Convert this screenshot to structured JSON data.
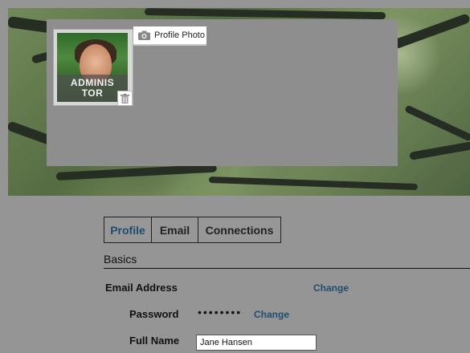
{
  "header": {
    "avatar_label": "ADMINIS\nTOR",
    "profile_photo_label": "Profile Photo"
  },
  "tabs": [
    {
      "label": "Profile",
      "active": true
    },
    {
      "label": "Email",
      "active": false
    },
    {
      "label": "Connections",
      "active": false
    }
  ],
  "section": {
    "title": "Basics"
  },
  "fields": {
    "email": {
      "label": "Email Address",
      "action": "Change"
    },
    "password": {
      "label": "Password",
      "masked_value": "••••••••",
      "action": "Change"
    },
    "full_name": {
      "label": "Full Name",
      "value": "Jane Hansen"
    }
  },
  "colors": {
    "accent_link": "#1f4d6e",
    "page_background": "#959595"
  },
  "icons": {
    "camera": "camera-icon",
    "trash": "trash-icon"
  }
}
